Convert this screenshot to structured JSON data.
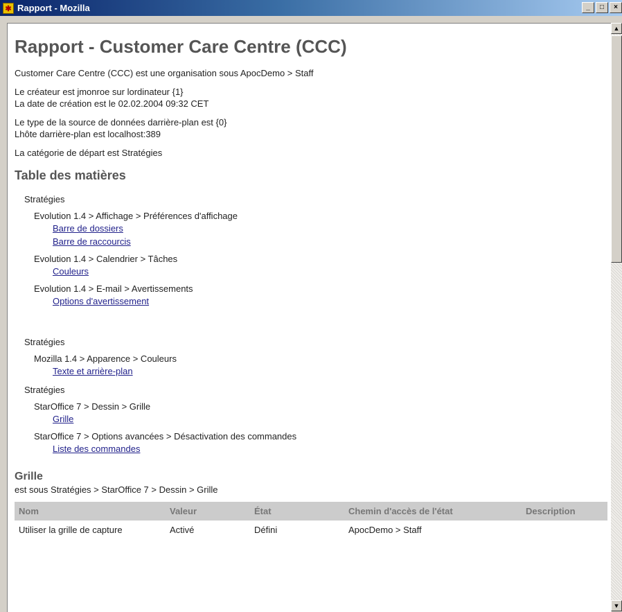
{
  "window": {
    "title": "Rapport - Mozilla",
    "icon": "app-icon",
    "buttons": {
      "minimize": "_",
      "maximize": "□",
      "close": "×"
    }
  },
  "report": {
    "heading": "Rapport - Customer Care Centre (CCC)",
    "org_line": "Customer Care Centre (CCC) est une organisation sous ApocDemo > Staff",
    "creator_line": "Le créateur est jmonroe sur lordinateur {1}",
    "date_line": "La date de création est le 02.02.2004 09:32 CET",
    "source_type_line": "Le type de la source de données darrière-plan est {0}",
    "host_line": "Lhôte darrière-plan est localhost:389",
    "category_line": "La catégorie de départ est Stratégies"
  },
  "toc": {
    "heading": "Table des matières",
    "groups": [
      {
        "title": "Stratégies",
        "items": [
          {
            "path": "Evolution 1.4 > Affichage > Préférences d'affichage",
            "links": [
              "Barre de dossiers",
              "Barre de raccourcis"
            ]
          },
          {
            "path": "Evolution 1.4 > Calendrier > Tâches",
            "links": [
              "Couleurs"
            ]
          },
          {
            "path": "Evolution 1.4 > E-mail > Avertissements",
            "links": [
              "Options d'avertissement"
            ]
          }
        ]
      },
      {
        "title": "Stratégies",
        "items": [
          {
            "path": "Mozilla 1.4 > Apparence > Couleurs",
            "links": [
              "Texte et arrière-plan"
            ]
          }
        ]
      },
      {
        "title": "Stratégies",
        "items": [
          {
            "path": "StarOffice 7 > Dessin > Grille",
            "links": [
              "Grille"
            ]
          },
          {
            "path": "StarOffice 7 > Options avancées > Désactivation des commandes",
            "links": [
              "Liste des commandes"
            ]
          }
        ]
      }
    ]
  },
  "section": {
    "heading": "Grille",
    "under": "est sous Stratégies > StarOffice 7 > Dessin > Grille",
    "columns": [
      "Nom",
      "Valeur",
      "État",
      "Chemin d'accès de l'état",
      "Description"
    ],
    "rows": [
      [
        "Utiliser la grille de capture",
        "Activé",
        "Défini",
        "ApocDemo > Staff",
        ""
      ]
    ]
  },
  "scrollbar": {
    "up": "▲",
    "down": "▼"
  }
}
